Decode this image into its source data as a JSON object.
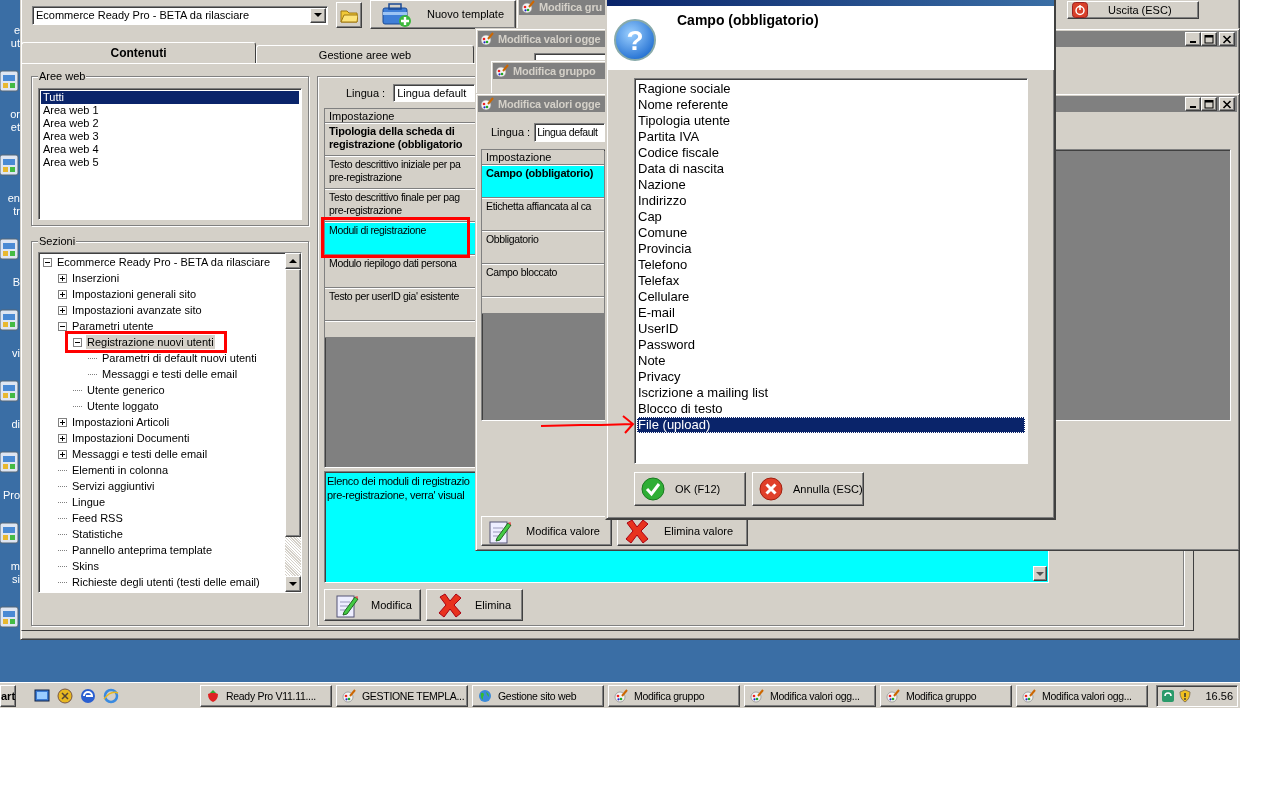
{
  "desktop_icons": [
    {
      "lines": "e\nut"
    },
    {
      "lines": "or\net"
    },
    {
      "lines": "en\ntr"
    },
    {
      "lines": "B"
    },
    {
      "lines": "vi"
    },
    {
      "lines": "di"
    },
    {
      "lines": "Pro"
    },
    {
      "lines": "m\nsi"
    }
  ],
  "main_window": {
    "template_select": "Ecommerce Ready Pro - BETA da rilasciare",
    "new_template_button": "Nuovo template",
    "exit_button": "Uscita (ESC)",
    "tabs": [
      {
        "label": "Contenuti",
        "selected": true
      },
      {
        "label": "Gestione aree web",
        "selected": false
      }
    ],
    "web_areas": {
      "title": "Aree web",
      "items": [
        {
          "label": "Tutti",
          "selected": true
        },
        {
          "label": "Area web 1",
          "selected": false
        },
        {
          "label": "Area web 2",
          "selected": false
        },
        {
          "label": "Area web 3",
          "selected": false
        },
        {
          "label": "Area web 4",
          "selected": false
        },
        {
          "label": "Area web 5",
          "selected": false
        }
      ]
    },
    "sections": {
      "title": "Sezioni",
      "tree": [
        {
          "label": "Ecommerce Ready Pro - BETA da rilasciare",
          "kind": "branch",
          "expanded": true,
          "selected": false,
          "circled": false,
          "children": [
            {
              "label": "Inserzioni",
              "kind": "branch",
              "expanded": false,
              "selected": false,
              "circled": false
            },
            {
              "label": "Impostazioni generali sito",
              "kind": "branch",
              "expanded": false,
              "selected": false,
              "circled": false
            },
            {
              "label": "Impostazioni avanzate sito",
              "kind": "branch",
              "expanded": false,
              "selected": false,
              "circled": false
            },
            {
              "label": "Parametri utente",
              "kind": "branch",
              "expanded": true,
              "selected": false,
              "circled": false,
              "children": [
                {
                  "label": "Registrazione nuovi utenti",
                  "kind": "branch",
                  "expanded": true,
                  "selected": true,
                  "circled": true,
                  "children": [
                    {
                      "label": "Parametri di default nuovi utenti",
                      "kind": "leaf",
                      "selected": false,
                      "circled": false
                    },
                    {
                      "label": "Messaggi e testi delle email",
                      "kind": "leaf",
                      "selected": false,
                      "circled": false
                    }
                  ]
                },
                {
                  "label": "Utente generico",
                  "kind": "leaf",
                  "selected": false,
                  "circled": false
                },
                {
                  "label": "Utente loggato",
                  "kind": "leaf",
                  "selected": false,
                  "circled": false
                }
              ]
            },
            {
              "label": "Impostazioni Articoli",
              "kind": "branch",
              "expanded": false,
              "selected": false,
              "circled": false
            },
            {
              "label": "Impostazioni Documenti",
              "kind": "branch",
              "expanded": false,
              "selected": false,
              "circled": false
            },
            {
              "label": "Messaggi e testi delle email",
              "kind": "branch",
              "expanded": false,
              "selected": false,
              "circled": false
            },
            {
              "label": "Elementi in colonna",
              "kind": "leaf",
              "selected": false,
              "circled": false
            },
            {
              "label": "Servizi aggiuntivi",
              "kind": "leaf",
              "selected": false,
              "circled": false
            },
            {
              "label": "Lingue",
              "kind": "leaf",
              "selected": false,
              "circled": false
            },
            {
              "label": "Feed RSS",
              "kind": "leaf",
              "selected": false,
              "circled": false
            },
            {
              "label": "Statistiche",
              "kind": "leaf",
              "selected": false,
              "circled": false
            },
            {
              "label": "Pannello anteprima template",
              "kind": "leaf",
              "selected": false,
              "circled": false
            },
            {
              "label": "Skins",
              "kind": "leaf",
              "selected": false,
              "circled": false
            },
            {
              "label": "Richieste degli utenti (testi delle email)",
              "kind": "leaf",
              "selected": false,
              "circled": false
            }
          ]
        }
      ]
    },
    "settings": {
      "language_label": "Lingua :",
      "language": "Lingua default",
      "header": "Impostazione",
      "rows": [
        {
          "text": "Tipologia della scheda di\nregistrazione (obbligatorio",
          "bold": true,
          "selected": false,
          "circled": false
        },
        {
          "text": "Testo descrittivo iniziale per pa\npre-registrazione",
          "bold": false,
          "selected": false,
          "circled": false
        },
        {
          "text": "Testo descrittivo finale per pag\npre-registrazione",
          "bold": false,
          "selected": false,
          "circled": false
        },
        {
          "text": "Moduli di registrazione",
          "bold": false,
          "selected": true,
          "circled": true
        },
        {
          "text": "Modulo riepilogo dati persona",
          "bold": false,
          "selected": false,
          "circled": false
        },
        {
          "text": "Testo per userID gia' esistente",
          "bold": false,
          "selected": false,
          "circled": false
        }
      ],
      "description": "Elenco dei moduli di registrazio\npre-registrazione, verra' visual",
      "buttons": [
        "Modifica",
        "Elimina"
      ]
    }
  },
  "background_windows": [
    {
      "title": "Modifica gru"
    },
    {
      "title": "Modifica valori ogge"
    },
    {
      "title": "Modifica gruppo"
    }
  ],
  "value_window": {
    "title": "Modifica valori ogge",
    "language_label": "Lingua :",
    "language": "Lingua default",
    "header": "Impostazione",
    "rows": [
      {
        "text": "Campo (obbligatorio)",
        "bold": true,
        "selected": true
      },
      {
        "text": "Etichetta affiancata al ca",
        "bold": false,
        "selected": false
      },
      {
        "text": "Obbligatorio",
        "bold": false,
        "selected": false
      },
      {
        "text": "Campo bloccato",
        "bold": false,
        "selected": false
      }
    ],
    "buttons": [
      "Modifica valore",
      "Elimina valore"
    ]
  },
  "dialog": {
    "icon": "?",
    "title": "Campo (obbligatorio)",
    "items": [
      {
        "label": "Ragione sociale",
        "selected": false,
        "arrow": false
      },
      {
        "label": "Nome referente",
        "selected": false,
        "arrow": false
      },
      {
        "label": "Tipologia utente",
        "selected": false,
        "arrow": false
      },
      {
        "label": "Partita IVA",
        "selected": false,
        "arrow": false
      },
      {
        "label": "Codice fiscale",
        "selected": false,
        "arrow": false
      },
      {
        "label": "Data di nascita",
        "selected": false,
        "arrow": false
      },
      {
        "label": "Nazione",
        "selected": false,
        "arrow": false
      },
      {
        "label": "Indirizzo",
        "selected": false,
        "arrow": false
      },
      {
        "label": "Cap",
        "selected": false,
        "arrow": false
      },
      {
        "label": "Comune",
        "selected": false,
        "arrow": false
      },
      {
        "label": "Provincia",
        "selected": false,
        "arrow": false
      },
      {
        "label": "Telefono",
        "selected": false,
        "arrow": false
      },
      {
        "label": "Telefax",
        "selected": false,
        "arrow": false
      },
      {
        "label": "Cellulare",
        "selected": false,
        "arrow": false
      },
      {
        "label": "E-mail",
        "selected": false,
        "arrow": false
      },
      {
        "label": "UserID",
        "selected": false,
        "arrow": false
      },
      {
        "label": "Password",
        "selected": false,
        "arrow": false
      },
      {
        "label": "Note",
        "selected": false,
        "arrow": false
      },
      {
        "label": "Privacy",
        "selected": false,
        "arrow": false
      },
      {
        "label": "Iscrizione a mailing list",
        "selected": false,
        "arrow": false
      },
      {
        "label": "Blocco di testo",
        "selected": false,
        "arrow": false
      },
      {
        "label": "File (upload)",
        "selected": true,
        "arrow": true
      }
    ],
    "buttons": [
      {
        "label": "OK (F12)",
        "kind": "ok"
      },
      {
        "label": "Annulla (ESC)",
        "kind": "cancel"
      }
    ]
  },
  "taskbar": {
    "start": "art",
    "tasks": [
      {
        "label": "Ready Pro V11.11....",
        "kind": "berry"
      },
      {
        "label": "GESTIONE TEMPLA...",
        "kind": "brush"
      },
      {
        "label": "Gestione sito web",
        "kind": "globe"
      },
      {
        "label": "Modifica gruppo",
        "kind": "brush"
      },
      {
        "label": "Modifica valori ogg...",
        "kind": "brush"
      },
      {
        "label": "Modifica gruppo",
        "kind": "brush"
      },
      {
        "label": "Modifica valori ogg...",
        "kind": "brush"
      }
    ],
    "clock": "16.56"
  }
}
